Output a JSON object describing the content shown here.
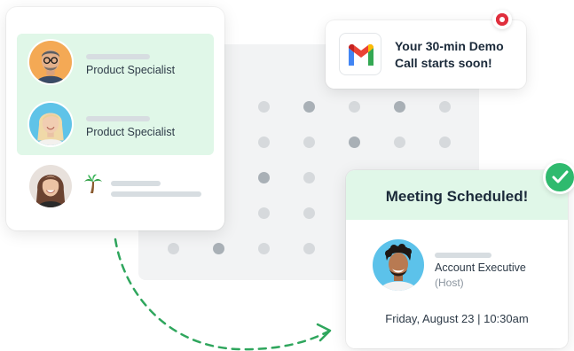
{
  "people_card": {
    "people": [
      {
        "role": "Product Specialist",
        "highlighted": true,
        "avatar_icon": "man-glasses-avatar"
      },
      {
        "role": "Product Specialist",
        "highlighted": true,
        "avatar_icon": "woman-blonde-avatar"
      },
      {
        "role": "",
        "highlighted": false,
        "avatar_icon": "woman-brunette-avatar",
        "status_icon": "palm-tree-icon"
      }
    ],
    "highlight_color": "#e0f7e8"
  },
  "notification": {
    "icon": "gmail-icon",
    "line1": "Your 30-min Demo",
    "line2": "Call starts soon!",
    "badge_color": "#e02f3d"
  },
  "meeting": {
    "title": "Meeting Scheduled!",
    "host_role": "Account Executive",
    "host_tag": "(Host)",
    "date": "Friday, August 23 | 10:30am",
    "status_icon": "check-icon",
    "accent": "#2fba6e"
  },
  "arrow_color": "#2fa65d"
}
